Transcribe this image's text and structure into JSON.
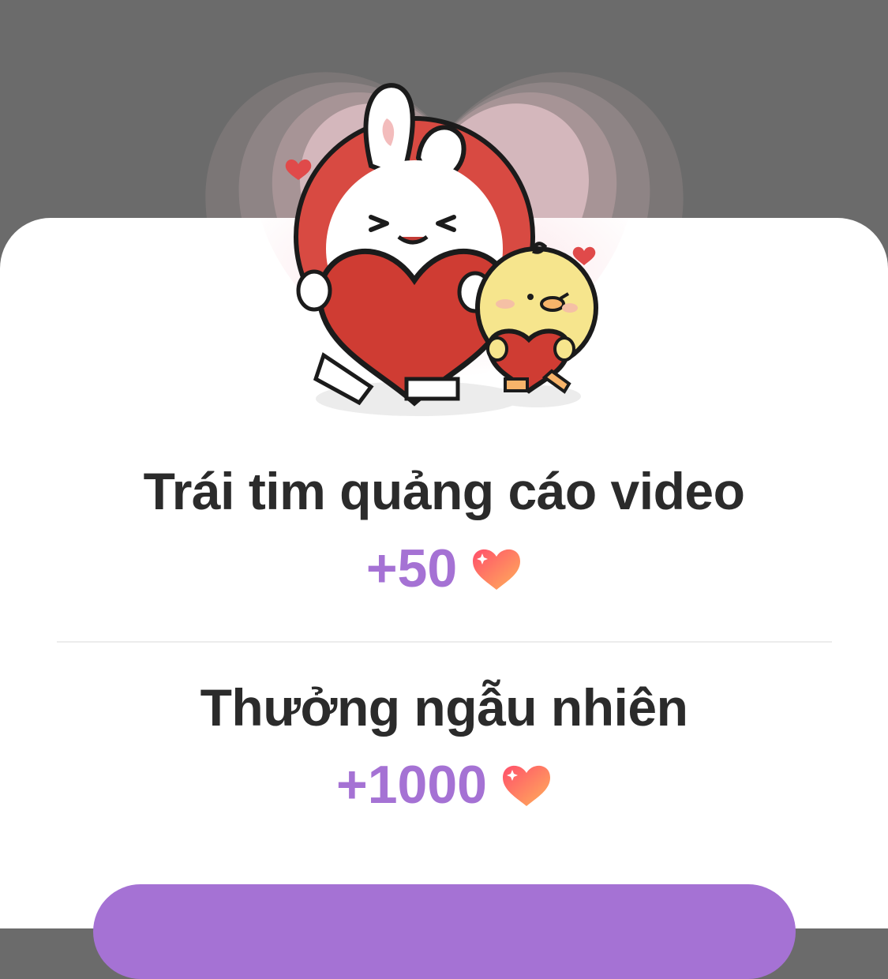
{
  "rewards": [
    {
      "title": "Trái tim quảng cáo video",
      "amount": "+50",
      "icon": "heart-icon"
    },
    {
      "title": "Thưởng ngẫu nhiên",
      "amount": "+1000",
      "icon": "heart-icon"
    }
  ],
  "colors": {
    "overlay": "#6b6b6b",
    "sheet": "#ffffff",
    "title_text": "#2b2b2b",
    "amount_text": "#a572d4",
    "heart_gradient_start": "#ff4f6b",
    "heart_gradient_end": "#ffb15a",
    "cta_button": "#a572d4"
  },
  "illustration": {
    "subject": "bunny-and-chick-holding-hearts"
  }
}
